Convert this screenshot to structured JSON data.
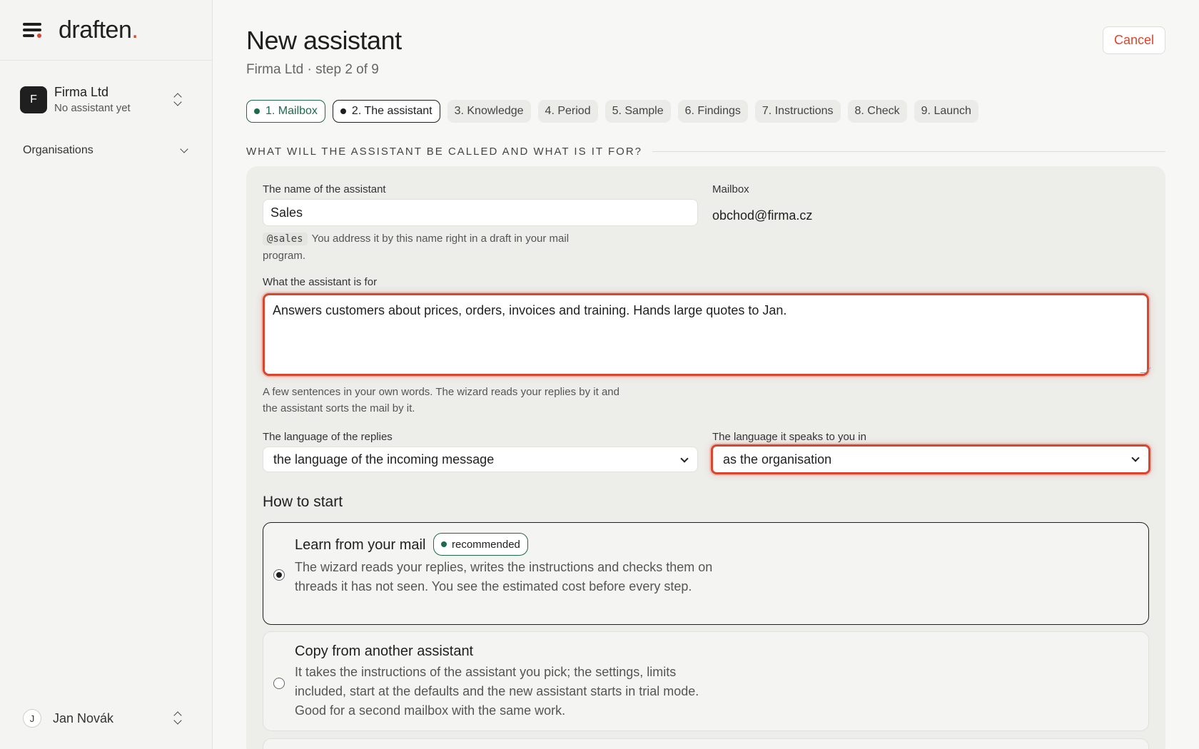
{
  "app": {
    "logo_text": "draften",
    "logo_dot": ".",
    "accent_color": "#d9462f",
    "success_color": "#1b6b4c"
  },
  "sidebar": {
    "org": {
      "initial": "F",
      "name": "Firma Ltd",
      "subtitle": "No assistant yet"
    },
    "organisations_label": "Organisations",
    "user": {
      "initial": "J",
      "name": "Jan Novák"
    }
  },
  "header": {
    "title": "New assistant",
    "subtitle": "Firma Ltd · step 2 of 9",
    "cancel_label": "Cancel"
  },
  "steps": [
    {
      "label": "1. Mailbox",
      "state": "done"
    },
    {
      "label": "2. The assistant",
      "state": "current"
    },
    {
      "label": "3. Knowledge",
      "state": "pending"
    },
    {
      "label": "4. Period",
      "state": "pending"
    },
    {
      "label": "5. Sample",
      "state": "pending"
    },
    {
      "label": "6. Findings",
      "state": "pending"
    },
    {
      "label": "7. Instructions",
      "state": "pending"
    },
    {
      "label": "8. Check",
      "state": "pending"
    },
    {
      "label": "9. Launch",
      "state": "pending"
    }
  ],
  "form": {
    "section_heading": "WHAT WILL THE ASSISTANT BE CALLED AND WHAT IS IT FOR?",
    "name": {
      "label": "The name of the assistant",
      "value": "Sales",
      "handle": "@sales",
      "help": "You address it by this name right in a draft in your mail program."
    },
    "mailbox": {
      "label": "Mailbox",
      "value": "obchod@firma.cz"
    },
    "purpose": {
      "label": "What the assistant is for",
      "value": "Answers customers about prices, orders, invoices and training. Hands large quotes to Jan.",
      "help": "A few sentences in your own words. The wizard reads your replies by it and the assistant sorts the mail by it."
    },
    "reply_language": {
      "label": "The language of the replies",
      "value": "the language of the incoming message"
    },
    "speak_language": {
      "label": "The language it speaks to you in",
      "value": "as the organisation"
    },
    "how_to_start": {
      "heading": "How to start",
      "options": [
        {
          "title": "Learn from your mail",
          "badge": "recommended",
          "selected": true,
          "description": "The wizard reads your replies, writes the instructions and checks them on threads it has not seen. You see the estimated cost before every step."
        },
        {
          "title": "Copy from another assistant",
          "selected": false,
          "description": "It takes the instructions of the assistant you pick; the settings, limits included, start at the defaults and the new assistant starts in trial mode. Good for a second mailbox with the same work."
        }
      ]
    }
  }
}
